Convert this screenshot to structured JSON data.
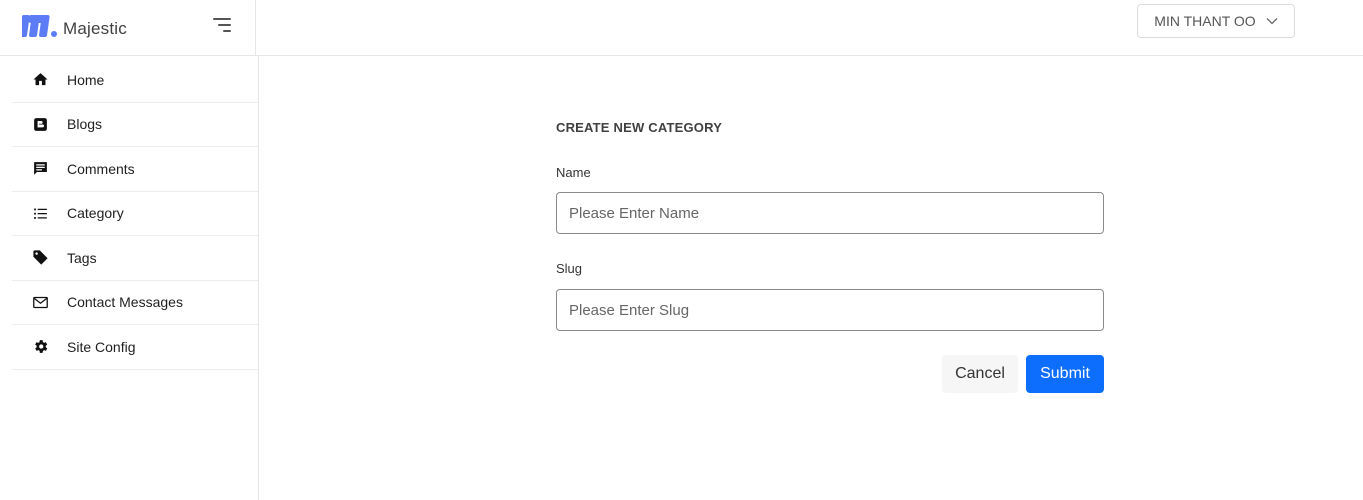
{
  "brand": {
    "name": "Majestic"
  },
  "header": {
    "user_name": "MIN THANT OO"
  },
  "sidebar": {
    "items": [
      {
        "label": "Home",
        "icon": "home-icon"
      },
      {
        "label": "Blogs",
        "icon": "blogger-icon"
      },
      {
        "label": "Comments",
        "icon": "comment-icon"
      },
      {
        "label": "Category",
        "icon": "list-icon"
      },
      {
        "label": "Tags",
        "icon": "tag-icon"
      },
      {
        "label": "Contact Messages",
        "icon": "mail-icon"
      },
      {
        "label": "Site Config",
        "icon": "gear-icon"
      }
    ]
  },
  "form": {
    "title": "CREATE NEW CATEGORY",
    "name_label": "Name",
    "name_placeholder": "Please Enter Name",
    "name_value": "",
    "slug_label": "Slug",
    "slug_placeholder": "Please Enter Slug",
    "slug_value": "",
    "cancel_label": "Cancel",
    "submit_label": "Submit"
  },
  "colors": {
    "accent": "#0d6efd",
    "logo": "#5b7cf5"
  }
}
